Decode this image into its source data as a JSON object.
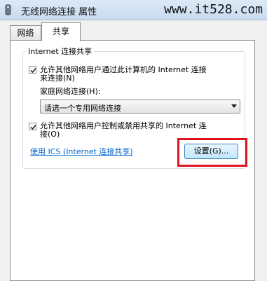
{
  "window": {
    "title": "无线网络连接 属性",
    "icon": "wireless-adapter-icon"
  },
  "watermark": "www.it528.com",
  "tabs": [
    {
      "label": "网络",
      "active": false
    },
    {
      "label": "共享",
      "active": true
    }
  ],
  "group": {
    "legend": "Internet 连接共享"
  },
  "allow_connect": {
    "checked": true,
    "line1": "允许其他网络用户通过此计算机的 Internet 连接",
    "line2": "来连接(N)"
  },
  "home_network": {
    "label": "家庭网络连接(H):",
    "selected": "请选一个专用网络连接"
  },
  "allow_control": {
    "checked": true,
    "line1": "允许其他网络用户控制或禁用共享的 Internet 连",
    "line2": "接(O)"
  },
  "ics_link": "使用 ICS (Internet 连接共享)",
  "settings_button": "设置(G)...",
  "colors": {
    "highlight": "#e0141e",
    "link": "#0066cc"
  }
}
